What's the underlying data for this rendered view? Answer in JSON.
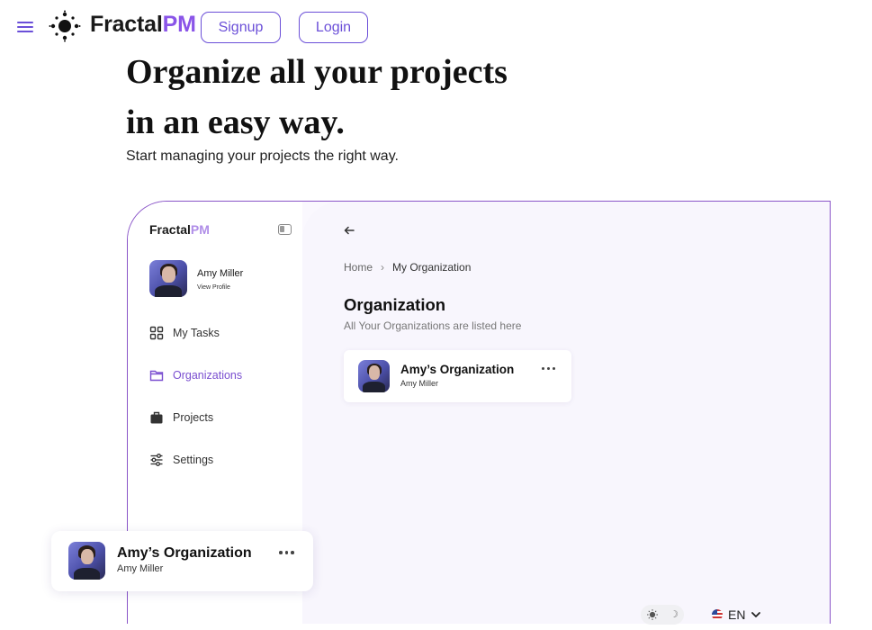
{
  "nav": {
    "brand_a": "Fractal",
    "brand_b": "PM",
    "signup_label": "Signup",
    "login_label": "Login"
  },
  "hero": {
    "title_line1": "Organize all your projects",
    "title_line2": "in an easy way.",
    "subtitle": "Start managing your projects the right way."
  },
  "preview": {
    "sidebar": {
      "brand_a": "Fractal",
      "brand_b": "PM",
      "user_name": "Amy Miller",
      "view_profile": "View Profile",
      "items": [
        {
          "label": "My Tasks",
          "icon": "grid-icon",
          "active": false
        },
        {
          "label": "Organizations",
          "icon": "folder-icon",
          "active": true
        },
        {
          "label": "Projects",
          "icon": "briefcase-icon",
          "active": false
        },
        {
          "label": "Settings",
          "icon": "sliders-icon",
          "active": false
        }
      ]
    },
    "main": {
      "breadcrumb": {
        "home": "Home",
        "separator": "›",
        "current": "My Organization"
      },
      "title": "Organization",
      "subtitle": "All Your Organizations are listed here",
      "card": {
        "title": "Amy’s Organization",
        "owner": "Amy Miller"
      }
    }
  },
  "floating_card": {
    "title": "Amy’s Organization",
    "owner": "Amy Miller"
  },
  "footer": {
    "language": "EN"
  },
  "colors": {
    "accent": "#6b4fd8",
    "brand_purple": "#8a55e8",
    "frame_border": "#8a55c8",
    "active_nav": "#7a4fd0"
  }
}
